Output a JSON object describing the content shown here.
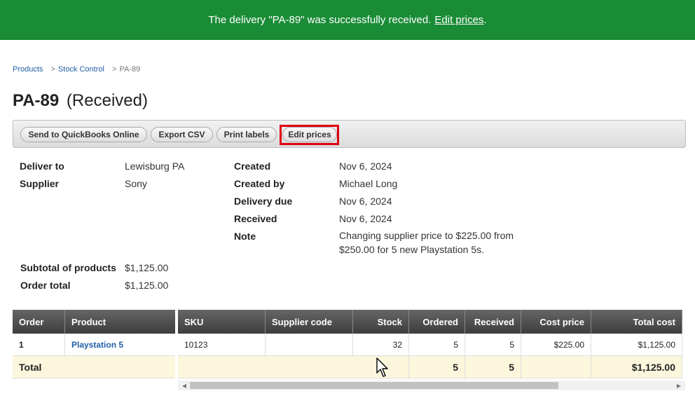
{
  "banner": {
    "message": "The delivery \"PA-89\" was successfully received.",
    "link": "Edit prices",
    "trailing": "."
  },
  "breadcrumb": {
    "items": [
      "Products",
      "Stock Control"
    ],
    "separator": ">",
    "current": "PA-89"
  },
  "title": {
    "code": "PA-89",
    "status": "(Received)"
  },
  "toolbar": {
    "buttons": [
      "Send to QuickBooks Online",
      "Export CSV",
      "Print labels",
      "Edit prices"
    ],
    "highlighted": "Edit prices"
  },
  "details": {
    "deliver_to": {
      "label": "Deliver to",
      "value": "Lewisburg PA"
    },
    "supplier": {
      "label": "Supplier",
      "value": "Sony"
    },
    "created": {
      "label": "Created",
      "value": "Nov 6, 2024"
    },
    "created_by": {
      "label": "Created by",
      "value": "Michael Long"
    },
    "delivery_due": {
      "label": "Delivery due",
      "value": "Nov 6, 2024"
    },
    "received": {
      "label": "Received",
      "value": "Nov 6, 2024"
    },
    "note": {
      "label": "Note",
      "value": "Changing supplier price to $225.00 from $250.00 for 5 new Playstation 5s."
    },
    "subtotal": {
      "label": "Subtotal of products",
      "value": "$1,125.00"
    },
    "order_total": {
      "label": "Order total",
      "value": "$1,125.00"
    }
  },
  "table": {
    "columns": [
      "Order",
      "Product",
      "SKU",
      "Supplier code",
      "Stock",
      "Ordered",
      "Received",
      "Cost price",
      "Total cost"
    ],
    "rows": [
      {
        "order": "1",
        "product": "Playstation 5",
        "sku": "10123",
        "supplier_code": "",
        "stock": "32",
        "ordered": "5",
        "received": "5",
        "cost_price": "$225.00",
        "total_cost": "$1,125.00"
      }
    ],
    "total": {
      "label": "Total",
      "ordered": "5",
      "received": "5",
      "total_cost": "$1,125.00"
    }
  },
  "colors": {
    "banner": "#1a8c36",
    "highlight": "#e0000f",
    "link": "#1f5fa6",
    "total_row": "#fcf6dc"
  }
}
